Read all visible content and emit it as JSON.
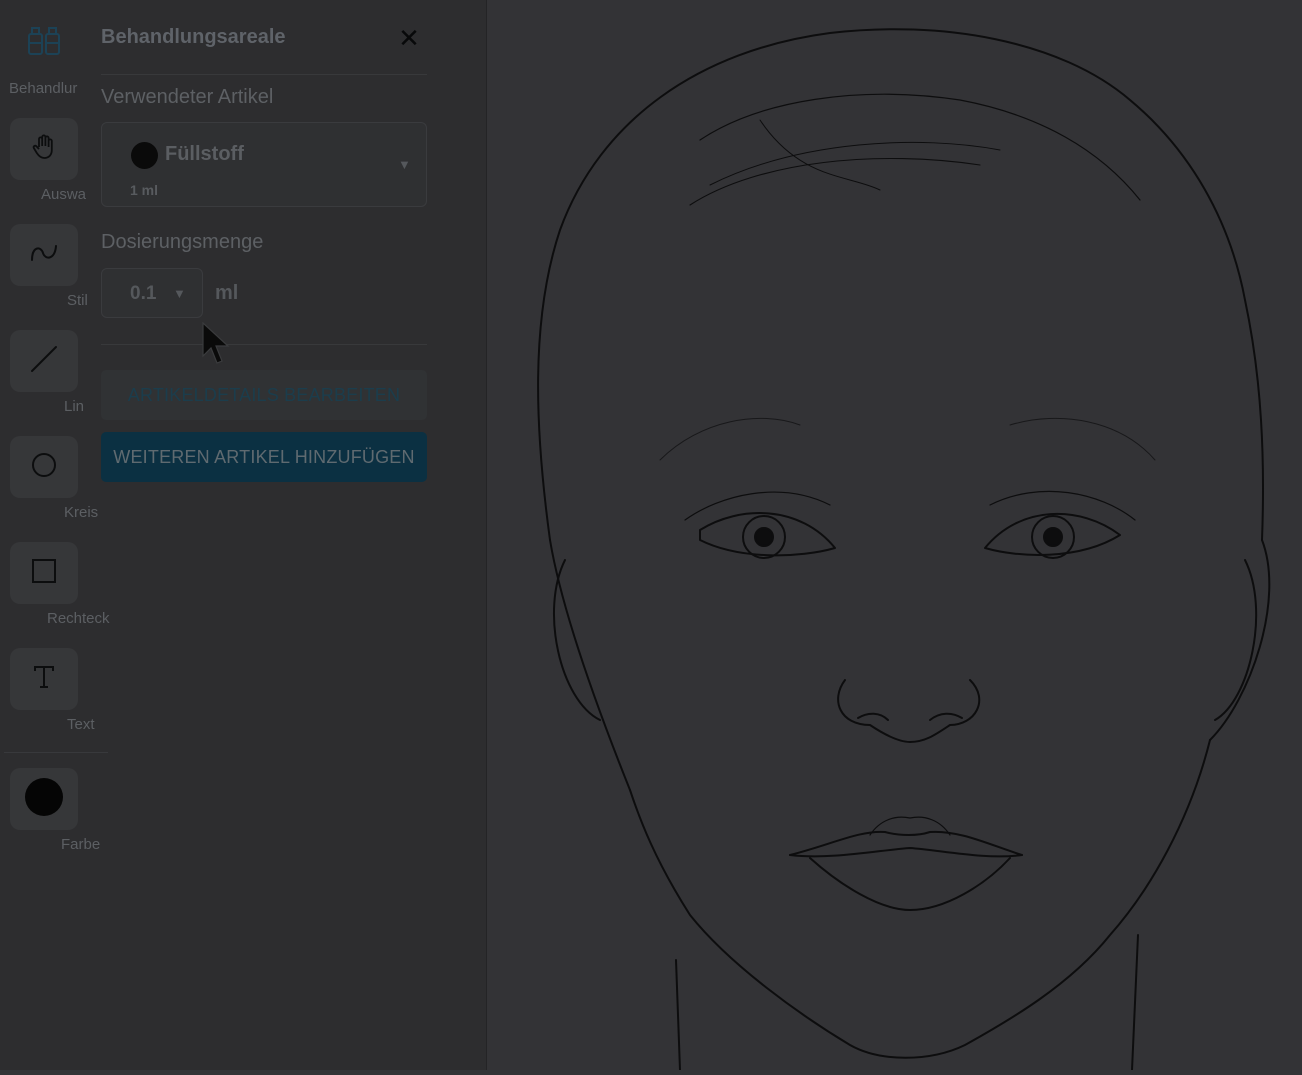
{
  "toolbar": {
    "tools": [
      {
        "label": "Behandlur",
        "icon": "treatment-areas-icon"
      },
      {
        "label": "Auswa",
        "icon": "hand-icon"
      },
      {
        "label": "Stil",
        "icon": "freehand-curve-icon"
      },
      {
        "label": "Lin",
        "icon": "line-icon"
      },
      {
        "label": "Kreis",
        "icon": "circle-icon"
      },
      {
        "label": "Rechteck",
        "icon": "rectangle-icon"
      },
      {
        "label": "Text",
        "icon": "text-icon"
      },
      {
        "label": "Farbe",
        "icon": "color-swatch-icon",
        "color": "#000000"
      }
    ]
  },
  "panel": {
    "title": "Behandlungsareale",
    "close_icon": "close-icon",
    "article_label": "Verwendeter Artikel",
    "article": {
      "name": "Füllstoff",
      "amount": "1 ml",
      "color": "#000000"
    },
    "dosage_label": "Dosierungsmenge",
    "dosage": {
      "value": "0.1",
      "unit": "ml"
    },
    "edit_button": "ARTIKELDETAILS BEARBEITEN",
    "add_button": "WEITEREN ARTIKEL HINZUFÜGEN"
  },
  "canvas": {
    "image": "face-outline-drawing"
  },
  "colors": {
    "accent": "#0b3042",
    "overlay": "#333336"
  }
}
